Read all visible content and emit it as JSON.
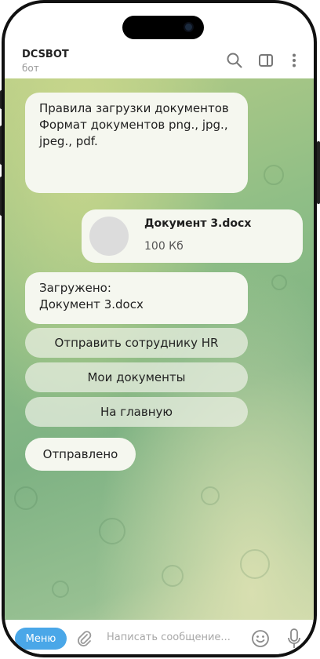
{
  "header": {
    "title": "DCSBOT",
    "subtitle": "бот",
    "icons": [
      "search-icon",
      "sidebar-panel-icon",
      "more-vertical-icon"
    ]
  },
  "messages": {
    "rules": {
      "line1": "Правила загрузки документов",
      "line2": "Формат документов png., jpg.,",
      "line3": "jpeg., pdf."
    },
    "document": {
      "name": "Документ 3.docx",
      "size": "100 Кб"
    },
    "uploaded": {
      "line1": "Загружено:",
      "line2": "Документ 3.docx"
    },
    "sent": "Отправлено"
  },
  "keyboard": {
    "send_hr": "Отправить сотруднику HR",
    "my_docs": "Мои документы",
    "home": "На главную"
  },
  "input": {
    "menu_label": "Меню",
    "placeholder": "Написать сообщение...",
    "icons": [
      "paperclip-icon",
      "emoji-icon",
      "microphone-icon"
    ]
  },
  "colors": {
    "accent": "#4aa7e8",
    "bubble": "#f5f7ef",
    "chat_bg": "#8fbe86"
  }
}
